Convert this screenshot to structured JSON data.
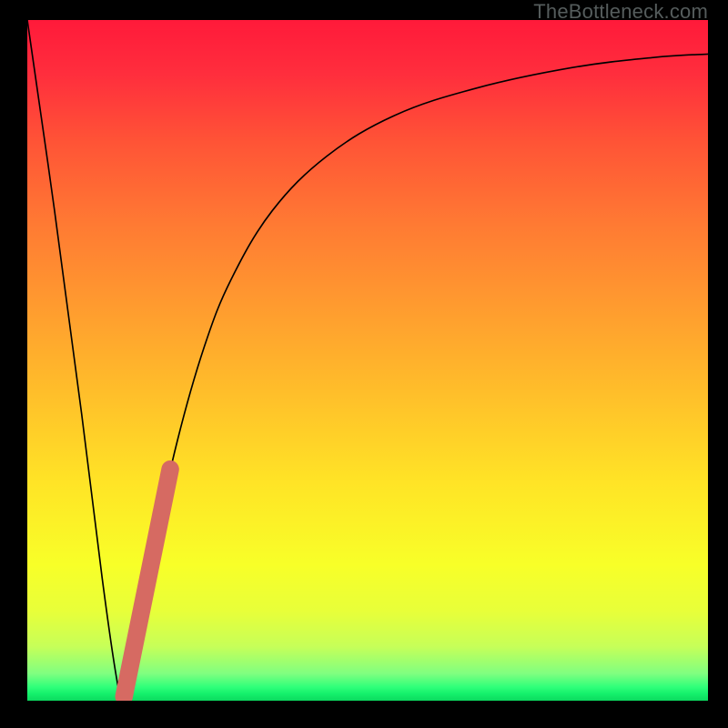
{
  "watermark": "TheBottleneck.com",
  "colors": {
    "frame": "#000000",
    "curve": "#000000",
    "marker": "#d66a62"
  },
  "chart_data": {
    "type": "line",
    "title": "",
    "xlabel": "",
    "ylabel": "",
    "xlim": [
      0,
      100
    ],
    "ylim": [
      0,
      100
    ],
    "series": [
      {
        "name": "bottleneck-curve",
        "x": [
          0,
          4,
          8,
          11,
          13,
          14,
          15,
          18,
          22,
          26,
          30,
          36,
          44,
          54,
          66,
          80,
          92,
          100
        ],
        "y": [
          100,
          72,
          42,
          18,
          4,
          0,
          4,
          20,
          38,
          52,
          62,
          72,
          80,
          86,
          90,
          93,
          94.5,
          95
        ]
      }
    ],
    "annotations": [
      {
        "name": "highlight-segment",
        "type": "line",
        "x1": 14.2,
        "y1": 0.6,
        "x2": 21.0,
        "y2": 34.0,
        "stroke_width": 2.6,
        "color": "#d66a62"
      }
    ]
  }
}
